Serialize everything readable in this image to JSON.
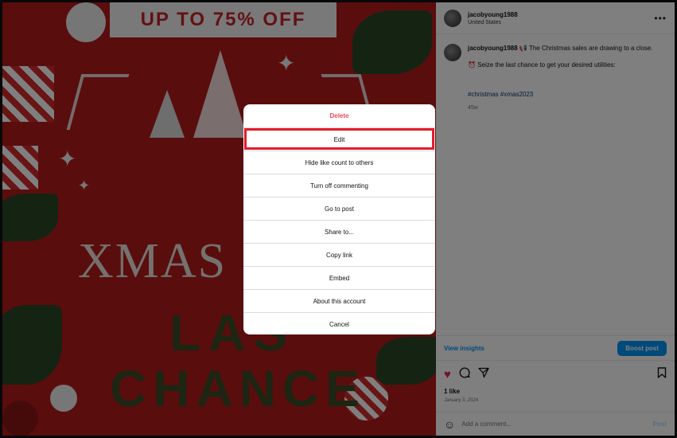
{
  "post_image": {
    "banner_text": "UP TO 75% OFF",
    "headline": "XMAS S",
    "line2": "LAS",
    "line3": "CHANCE"
  },
  "post_header": {
    "username": "jacobyoung1988",
    "location": "United States",
    "more_label": "•••"
  },
  "caption": {
    "username": "jacobyoung1988",
    "line1": "📢 The Christmas sales are drawing to a close.",
    "line2": "⏰ Seize the last chance to get your desired utilities:",
    "hashtags": "#christmas #xmas2023",
    "age": "45w"
  },
  "insights": {
    "view_label": "View insights",
    "boost_label": "Boost post"
  },
  "actions": {
    "like_icon": "heart-icon",
    "comment_icon": "comment-icon",
    "share_icon": "share-icon",
    "save_icon": "bookmark-icon"
  },
  "likes": {
    "count_text": "1 like",
    "date": "January 3, 2024"
  },
  "comment": {
    "placeholder": "Add a comment...",
    "post_label": "Post"
  },
  "menu": {
    "items": [
      {
        "label": "Delete"
      },
      {
        "label": "Edit"
      },
      {
        "label": "Hide like count to others"
      },
      {
        "label": "Turn off commenting"
      },
      {
        "label": "Go to post"
      },
      {
        "label": "Share to..."
      },
      {
        "label": "Copy link"
      },
      {
        "label": "Embed"
      },
      {
        "label": "About this account"
      },
      {
        "label": "Cancel"
      }
    ]
  },
  "colors": {
    "danger": "#ed4956",
    "accent": "#0095f6",
    "highlight_outline": "#e21b2c",
    "image_bg": "#b51b1b"
  }
}
